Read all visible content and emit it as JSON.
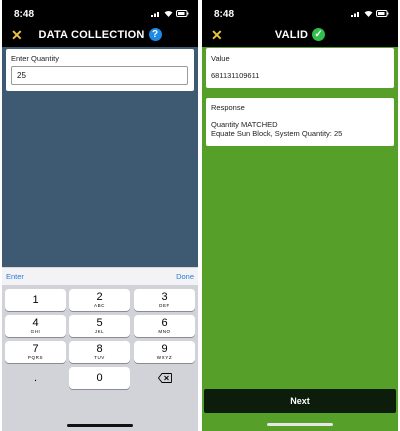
{
  "left": {
    "time": "8:48",
    "title": "DATA COLLECTION",
    "help_icon_glyph": "?",
    "form": {
      "label": "Enter Quantity",
      "value": "25"
    },
    "keyboard": {
      "enter": "Enter",
      "done": "Done",
      "keys": [
        {
          "digit": "1",
          "letters": ""
        },
        {
          "digit": "2",
          "letters": "ABC"
        },
        {
          "digit": "3",
          "letters": "DEF"
        },
        {
          "digit": "4",
          "letters": "GHI"
        },
        {
          "digit": "5",
          "letters": "JKL"
        },
        {
          "digit": "6",
          "letters": "MNO"
        },
        {
          "digit": "7",
          "letters": "PQRS"
        },
        {
          "digit": "8",
          "letters": "TUV"
        },
        {
          "digit": "9",
          "letters": "WXYZ"
        },
        {
          "digit": ".",
          "letters": ""
        },
        {
          "digit": "0",
          "letters": ""
        }
      ]
    }
  },
  "right": {
    "time": "8:48",
    "title": "VALID",
    "check_glyph": "✓",
    "value_card": {
      "label": "Value",
      "value": "681131109611"
    },
    "response_card": {
      "label": "Response",
      "line1": "Quantity MATCHED",
      "line2": "Equate Sun Block, System Quantity: 25"
    },
    "next_label": "Next"
  },
  "close_glyph": "✕",
  "colors": {
    "accent_yellow": "#e9c33a",
    "form_bg": "#3e5a72",
    "valid_green": "#56a02a",
    "link_blue": "#2a7ad6"
  }
}
